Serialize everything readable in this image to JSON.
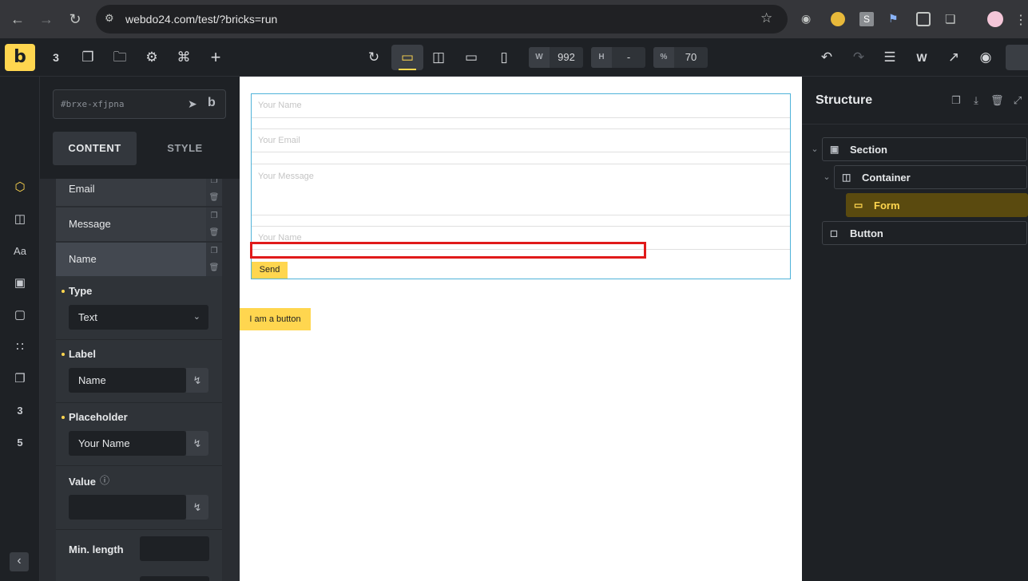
{
  "browser": {
    "url": "webdo24.com/test/?bricks=run"
  },
  "toolbar": {
    "logo": "b",
    "width": {
      "key": "W",
      "value": "992"
    },
    "height": {
      "key": "H",
      "value": "-"
    },
    "zoom": {
      "key": "%",
      "value": "70"
    }
  },
  "panel": {
    "element_id": "#brxe-xfjpna",
    "tabs": {
      "content": "CONTENT",
      "style": "STYLE"
    },
    "repeater_items": [
      "Email",
      "Message",
      "Name"
    ],
    "type_label": "Type",
    "type_value": "Text",
    "label_label": "Label",
    "label_value": "Name",
    "placeholder_label": "Placeholder",
    "placeholder_value": "Your Name",
    "value_label": "Value",
    "value_value": "",
    "minlength_label": "Min. length",
    "minlength_value": ""
  },
  "canvas": {
    "form_fields": [
      "Your Name",
      "Your Email",
      "Your Message",
      "Your Name"
    ],
    "send_label": "Send",
    "button_label": "I am a button"
  },
  "structure": {
    "title": "Structure",
    "nodes": [
      "Section",
      "Container",
      "Form",
      "Button"
    ]
  },
  "colors": {
    "accent": "#ffd64f",
    "highlight": "#e01a1a",
    "form_border": "#4fb3d9"
  }
}
